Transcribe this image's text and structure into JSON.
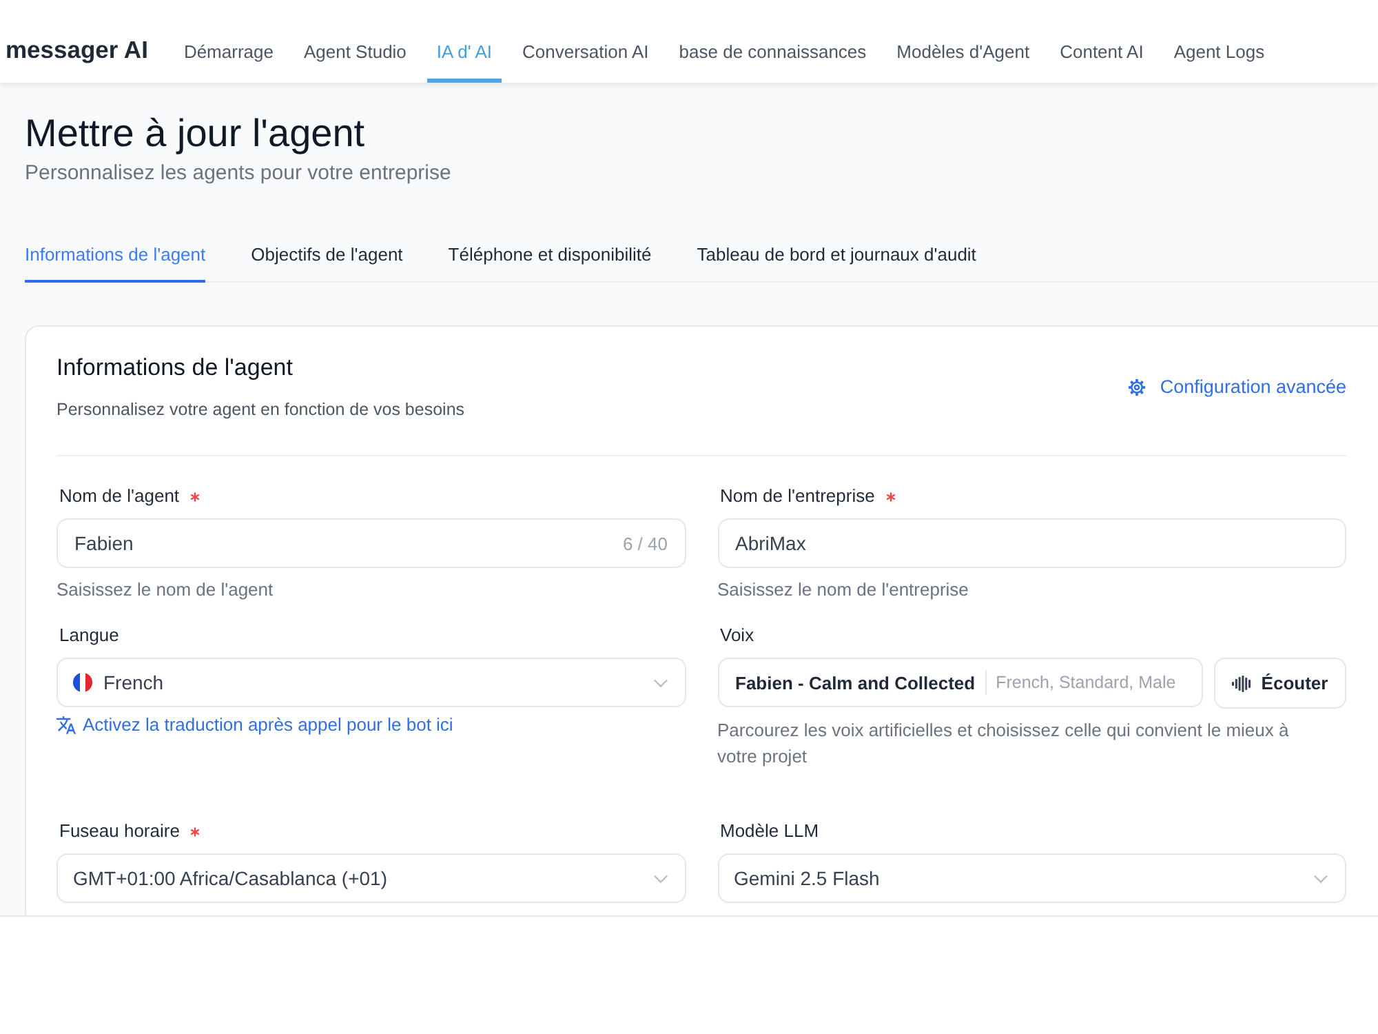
{
  "nav": {
    "brand": "messager AI",
    "items": [
      {
        "label": "Démarrage",
        "selected": false
      },
      {
        "label": "Agent Studio",
        "selected": false
      },
      {
        "label": "IA d' AI",
        "selected": true
      },
      {
        "label": "Conversation AI",
        "selected": false
      },
      {
        "label": "base de connaissances",
        "selected": false
      },
      {
        "label": "Modèles d'Agent",
        "selected": false
      },
      {
        "label": "Content AI",
        "selected": false
      },
      {
        "label": "Agent Logs",
        "selected": false
      }
    ]
  },
  "header": {
    "title": "Mettre à jour l'agent",
    "subtitle": "Personnalisez les agents pour votre entreprise"
  },
  "tabs": [
    {
      "label": "Informations de l'agent",
      "selected": true
    },
    {
      "label": "Objectifs de l'agent",
      "selected": false
    },
    {
      "label": "Téléphone et disponibilité",
      "selected": false
    },
    {
      "label": "Tableau de bord et journaux d'audit",
      "selected": false
    }
  ],
  "card": {
    "title": "Informations de l'agent",
    "description": "Personnalisez votre agent en fonction de vos besoins",
    "advanced_link": "Configuration avancée",
    "fields": [
      {
        "kind": "text",
        "label": "Nom de l'agent",
        "required": true,
        "value": "Fabien",
        "counter": "6 / 40",
        "hint": "Saisissez le nom de l'agent"
      },
      {
        "kind": "text",
        "label": "Nom de l'entreprise",
        "required": true,
        "value": "AbriMax",
        "hint": "Saisissez le nom de l'entreprise"
      },
      {
        "kind": "language",
        "label": "Langue",
        "required": false,
        "value": "French",
        "link": "Activez la traduction après appel pour le bot ici"
      },
      {
        "kind": "voice",
        "label": "Voix",
        "required": false,
        "voice_name": "Fabien - Calm and Collected",
        "voice_details": "French, Standard, Male",
        "button": "Écouter",
        "hint": "Parcourez les voix artificielles et choisissez celle qui convient le mieux à votre projet"
      },
      {
        "kind": "select",
        "label": "Fuseau horaire",
        "required": true,
        "value": "GMT+01:00 Africa/Casablanca (+01)"
      },
      {
        "kind": "select",
        "label": "Modèle LLM",
        "required": false,
        "value": "Gemini 2.5 Flash"
      }
    ]
  }
}
